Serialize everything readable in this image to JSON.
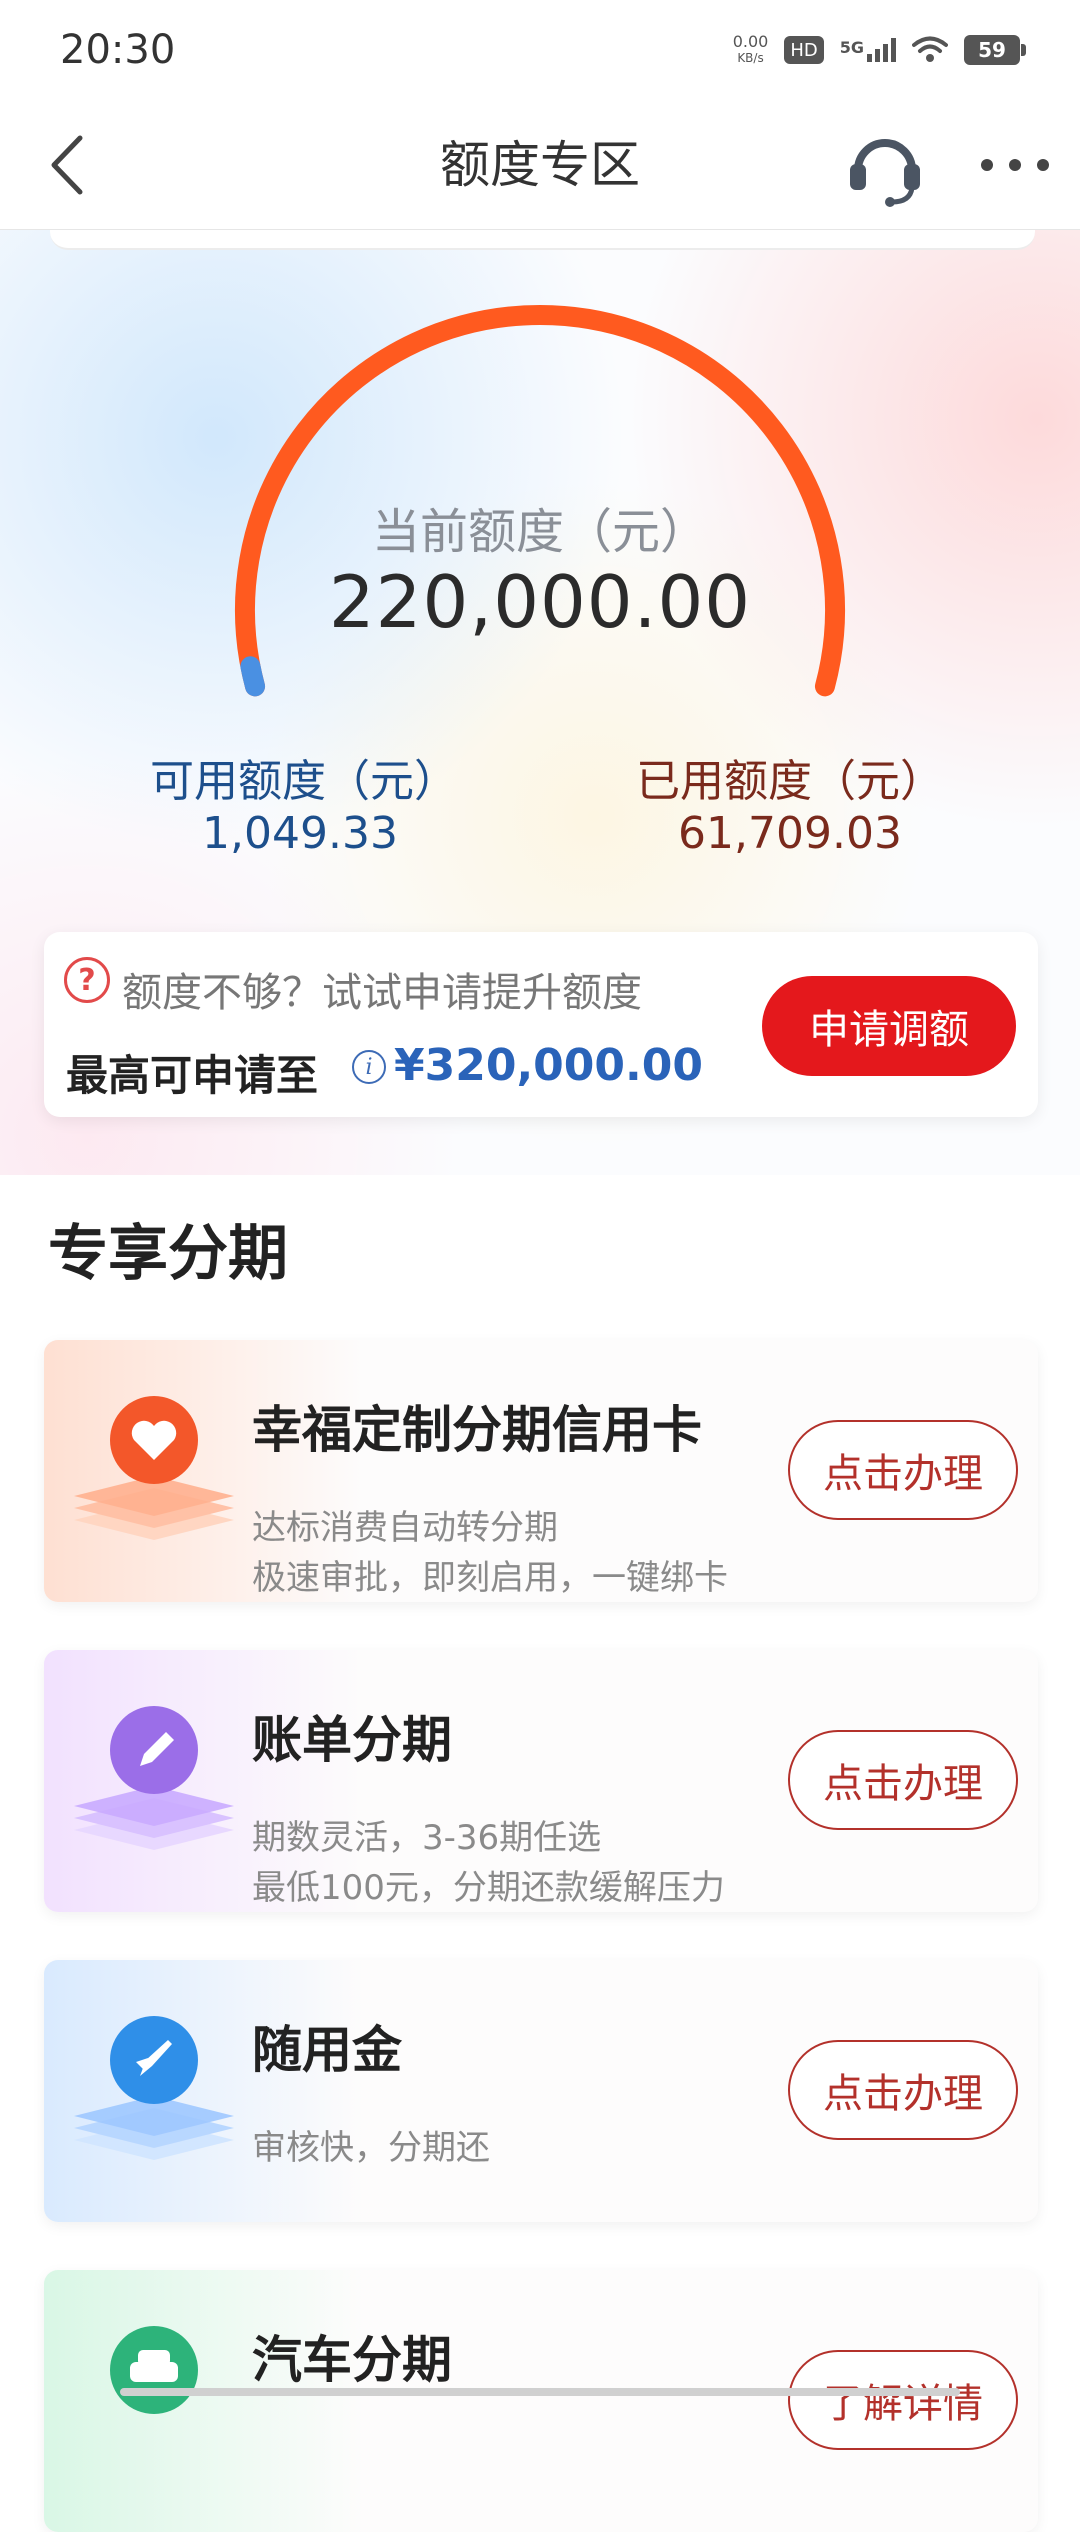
{
  "status_bar": {
    "time": "20:30",
    "net_speed_value": "0.00",
    "net_speed_unit": "KB/s",
    "hd_badge": "HD",
    "signal_badge": "5G",
    "battery": "59",
    "icons": [
      "hd-icon",
      "signal-5g-icon",
      "wifi-icon",
      "battery-icon"
    ]
  },
  "header": {
    "title": "额度专区",
    "back_icon": "chevron-left-icon",
    "service_icon": "headset-icon",
    "more_icon": "more-dots-icon"
  },
  "credit": {
    "current_label": "当前额度（元）",
    "current_value": "220,000.00",
    "available_label": "可用额度（元）",
    "available_value": "1,049.33",
    "used_label": "已用额度（元）",
    "used_value": "61,709.03",
    "available_fraction": 0.00477,
    "colors": {
      "arc": "#ff5a1f",
      "available": "#4a90e2"
    }
  },
  "boost": {
    "hint": "额度不够？试试申请提升额度",
    "max_label": "最高可申请至",
    "max_amount": "¥320,000.00",
    "apply_label": "申请调额",
    "hint_icon": "question-circle-icon",
    "info_icon": "info-icon"
  },
  "section": {
    "title": "专享分期"
  },
  "products": [
    {
      "title": "幸福定制分期信用卡",
      "desc": [
        "达标消费自动转分期",
        "极速审批，即刻启用，一键绑卡"
      ],
      "button": "点击办理",
      "icon": "heart-icon",
      "color": "#f3572a"
    },
    {
      "title": "账单分期",
      "desc": [
        "期数灵活，3-36期任选",
        "最低100元，分期还款缓解压力"
      ],
      "button": "点击办理",
      "icon": "pencil-icon",
      "color": "#9b6ee8"
    },
    {
      "title": "随用金",
      "desc": [
        "审核快，分期还"
      ],
      "button": "点击办理",
      "icon": "rocket-icon",
      "color": "#2f8fe8"
    },
    {
      "title": "汽车分期",
      "desc": [],
      "button": "了解详情",
      "icon": "car-icon",
      "color": "#2db37a"
    }
  ]
}
